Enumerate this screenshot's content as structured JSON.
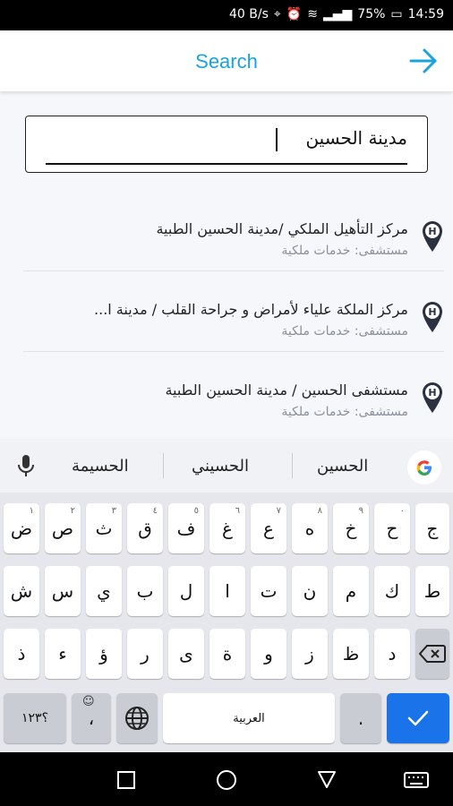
{
  "status_bar": {
    "net_speed": "40 B/s",
    "battery": "75%",
    "time": "14:59",
    "icons": [
      "location-icon",
      "alarm-icon",
      "wifi-icon",
      "signal-icon",
      "battery-icon"
    ]
  },
  "app_bar": {
    "title": "Search",
    "forward_icon": "arrow-right-icon"
  },
  "search": {
    "value": "مدينة الحسين"
  },
  "results": [
    {
      "title": "مركز التأهيل الملكي /مدينة الحسين الطبية",
      "subtitle": "مستشفى: خدمات ملكية"
    },
    {
      "title": "مركز الملكة علياء لأمراض و جراحة القلب / مدينة ا...",
      "subtitle": "مستشفى: خدمات ملكية"
    },
    {
      "title": "مستشفى الحسين / مدينة الحسين الطبية",
      "subtitle": "مستشفى: خدمات ملكية"
    }
  ],
  "keyboard": {
    "suggestions": [
      "الحسين",
      "الحسيني",
      "الحسيمة"
    ],
    "rows": [
      [
        "ض",
        "ص",
        "ث",
        "ق",
        "ف",
        "غ",
        "ع",
        "ه",
        "خ",
        "ح",
        "ج"
      ],
      [
        "ش",
        "س",
        "ي",
        "ب",
        "ل",
        "ا",
        "ت",
        "ن",
        "م",
        "ك",
        "ط"
      ],
      [
        "ذ",
        "ء",
        "ؤ",
        "ر",
        "ى",
        "ة",
        "و",
        "ز",
        "ظ",
        "د"
      ]
    ],
    "row1_small": [
      "١",
      "٢",
      "٣",
      "٤",
      "٥",
      "٦",
      "٧",
      "٨",
      "٩",
      "٠",
      ""
    ],
    "symbols_key": "؟١٢٣",
    "comma_key": "،",
    "space_label": "العربية",
    "period_key": ".",
    "accent": "#1a73e8"
  },
  "nav_bar": {
    "icons": [
      "back-square-icon",
      "home-circle-icon",
      "recent-triangle-icon",
      "keyboard-icon"
    ]
  }
}
